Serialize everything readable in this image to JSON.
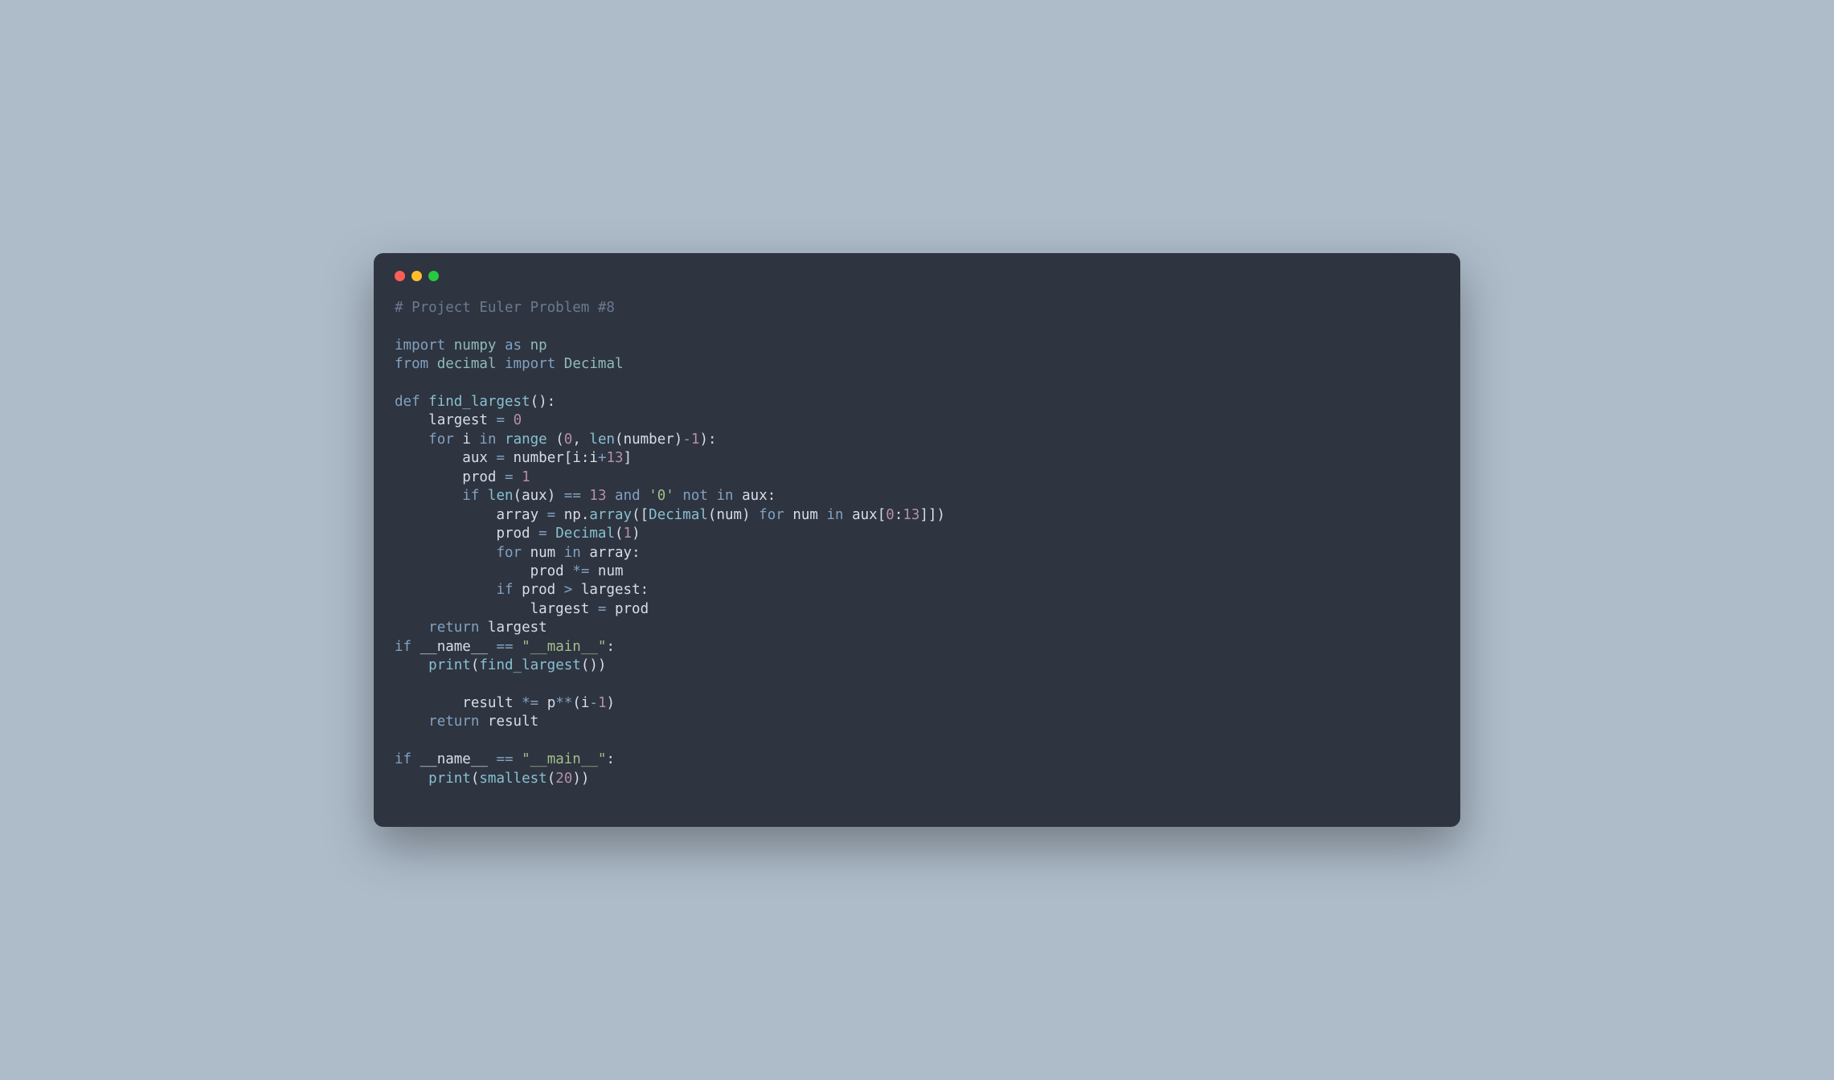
{
  "code": {
    "l01_comment": "# Project Euler Problem #8",
    "l03_import": "import",
    "l03_numpy": "numpy",
    "l03_as": "as",
    "l03_np": "np",
    "l04_from": "from",
    "l04_decimal": "decimal",
    "l04_import": "import",
    "l04_Decimal": "Decimal",
    "l06_def": "def",
    "l06_find_largest": "find_largest",
    "l06_parens": "():",
    "l07_largest": "largest",
    "l07_eq": "=",
    "l07_zero": "0",
    "l08_for": "for",
    "l08_i": "i",
    "l08_in": "in",
    "l08_range": "range",
    "l08_open": " (",
    "l08_zero": "0",
    "l08_comma": ", ",
    "l08_len": "len",
    "l08_lp": "(",
    "l08_number": "number",
    "l08_rp": ")",
    "l08_minus": "-",
    "l08_one": "1",
    "l08_close": "):",
    "l09_aux": "aux",
    "l09_eq": "=",
    "l09_number": "number",
    "l09_lb": "[",
    "l09_i1": "i",
    "l09_colon": ":",
    "l09_i2": "i",
    "l09_plus": "+",
    "l09_thirteen": "13",
    "l09_rb": "]",
    "l10_prod": "prod",
    "l10_eq": "=",
    "l10_one": "1",
    "l11_if": "if",
    "l11_len": "len",
    "l11_lp": "(",
    "l11_aux": "aux",
    "l11_rp": ")",
    "l11_eqeq": "==",
    "l11_thirteen": "13",
    "l11_and": "and",
    "l11_zerostr": "'0'",
    "l11_not": "not",
    "l11_in": "in",
    "l11_aux2": "aux",
    "l11_colon": ":",
    "l12_array": "array",
    "l12_eq": "=",
    "l12_np": "np",
    "l12_dot": ".",
    "l12_arrayfn": "array",
    "l12_open": "([",
    "l12_Decimal": "Decimal",
    "l12_lp": "(",
    "l12_num": "num",
    "l12_rp": ")",
    "l12_for": "for",
    "l12_num2": "num",
    "l12_in": "in",
    "l12_aux": "aux",
    "l12_lb": "[",
    "l12_zero": "0",
    "l12_colon": ":",
    "l12_thirteen": "13",
    "l12_rb": "]])",
    "l13_prod": "prod",
    "l13_eq": "=",
    "l13_Decimal": "Decimal",
    "l13_lp": "(",
    "l13_one": "1",
    "l13_rp": ")",
    "l14_for": "for",
    "l14_num": "num",
    "l14_in": "in",
    "l14_array": "array",
    "l14_colon": ":",
    "l15_prod": "prod",
    "l15_starEq": "*=",
    "l15_num": "num",
    "l16_if": "if",
    "l16_prod": "prod",
    "l16_gt": ">",
    "l16_largest": "largest",
    "l16_colon": ":",
    "l17_largest": "largest",
    "l17_eq": "=",
    "l17_prod": "prod",
    "l18_return": "return",
    "l18_largest": "largest",
    "l19_if": "if",
    "l19_name": "__name__",
    "l19_eqeq": "==",
    "l19_main": "\"__main__\"",
    "l19_colon": ":",
    "l20_print": "print",
    "l20_lp": "(",
    "l20_find_largest": "find_largest",
    "l20_rp": "())",
    "l22_result": "result",
    "l22_starEq": "*=",
    "l22_p": "p",
    "l22_pow": "**",
    "l22_lp": "(",
    "l22_i": "i",
    "l22_minus": "-",
    "l22_one": "1",
    "l22_rp": ")",
    "l23_return": "return",
    "l23_result": "result",
    "l25_if": "if",
    "l25_name": "__name__",
    "l25_eqeq": "==",
    "l25_main": "\"__main__\"",
    "l25_colon": ":",
    "l26_print": "print",
    "l26_lp": "(",
    "l26_smallest": "smallest",
    "l26_lp2": "(",
    "l26_twenty": "20",
    "l26_rp": "))"
  }
}
